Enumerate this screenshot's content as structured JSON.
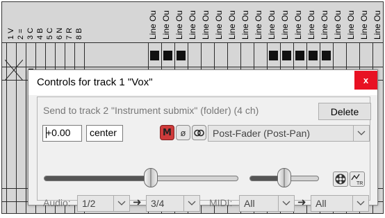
{
  "matrix": {
    "channel_numbers": [
      "1",
      "2",
      "3",
      "4",
      "5",
      "6",
      "7",
      "8"
    ],
    "channel_glyphs": [
      "V",
      "=",
      "C",
      "B",
      "C",
      "N",
      "R",
      "B"
    ],
    "line_label": "Line Ou"
  },
  "dialog": {
    "title": "Controls for track 1 \"Vox\"",
    "close_glyph": "x",
    "send_label": "Send to track 2 \"Instrument submix\" (folder) (4 ch)",
    "delete_label": "Delete",
    "volume_value": "+0.00",
    "pan_value": "center",
    "mute_label": "M",
    "phase_label": "ø",
    "mode_selected": "Post-Fader (Post-Pan)",
    "volume_level": 0.55,
    "pan_level": 0.5,
    "audio_label": "Audio:",
    "audio_src": "1/2",
    "audio_dst": "3/4",
    "midi_label": "MIDI:",
    "midi_src": "All",
    "midi_dst": "All",
    "route_arrow": "➜"
  },
  "colors": {
    "close_bg": "#e81123",
    "mute_bg": "#cf3b3b",
    "matrix_bg": "#d6d6d6"
  }
}
